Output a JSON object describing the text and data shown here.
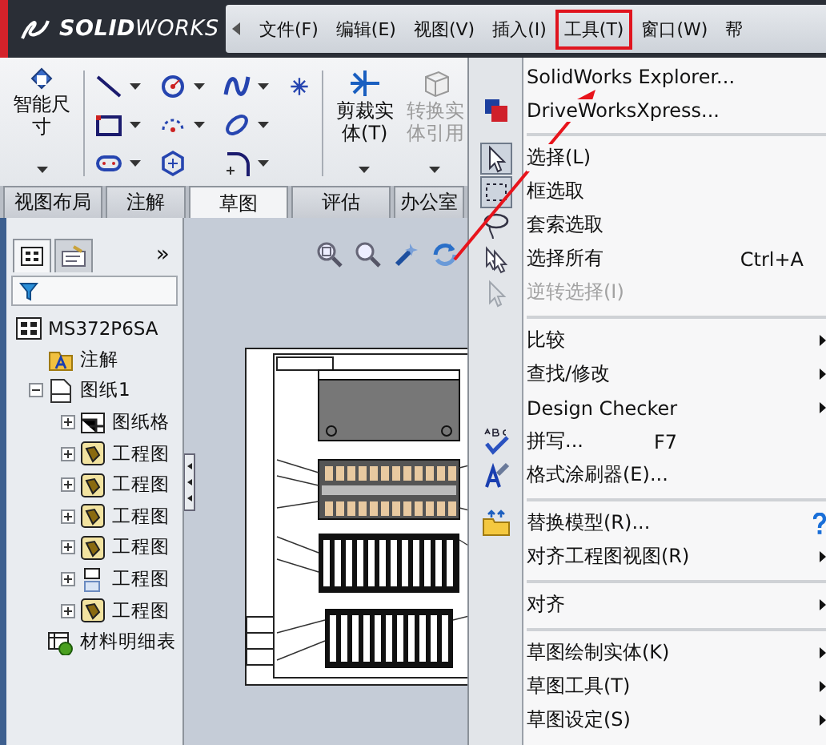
{
  "app": {
    "logo": "**SOLID**WORKS"
  },
  "menubar": {
    "items": [
      {
        "label": "文件(F)",
        "selected": false
      },
      {
        "label": "编辑(E)",
        "selected": false
      },
      {
        "label": "视图(V)",
        "selected": false
      },
      {
        "label": "插入(I)",
        "selected": false
      },
      {
        "label": "工具(T)",
        "selected": true
      },
      {
        "label": "窗口(W)",
        "selected": false
      },
      {
        "label": "帮",
        "selected": false
      }
    ]
  },
  "toolbar": {
    "buttons": [
      {
        "label": "智能尺寸",
        "disabled": false
      },
      {
        "label": "剪裁实体(T)",
        "disabled": false
      },
      {
        "label": "转换实体引用",
        "disabled": true
      }
    ]
  },
  "tabs": [
    {
      "label": "视图布局",
      "selected": false
    },
    {
      "label": "注解",
      "selected": false
    },
    {
      "label": "草图",
      "selected": true
    },
    {
      "label": "评估",
      "selected": false
    },
    {
      "label": "办公室",
      "selected": false
    }
  ],
  "panel": {
    "more": "»",
    "tree": {
      "label": "MS372P6SA",
      "kind": "drawing",
      "children": [
        {
          "label": "注解",
          "kind": "annotations"
        },
        {
          "label": "图纸1",
          "kind": "sheet",
          "expanded": true,
          "children": [
            {
              "label": "图纸格",
              "kind": "format",
              "expanded": false
            },
            {
              "label": "工程图",
              "kind": "view",
              "expanded": false
            },
            {
              "label": "工程图",
              "kind": "view",
              "expanded": false
            },
            {
              "label": "工程图",
              "kind": "view",
              "expanded": false
            },
            {
              "label": "工程图",
              "kind": "view",
              "expanded": false
            },
            {
              "label": "工程图",
              "kind": "blankview",
              "expanded": false
            },
            {
              "label": "工程图",
              "kind": "view",
              "expanded": false
            }
          ]
        },
        {
          "label": "材料明细表",
          "kind": "bom"
        }
      ]
    }
  },
  "menu": {
    "items": [
      {
        "kind": "item",
        "label": "SolidWorks Explorer...",
        "checked": false,
        "disabled": false,
        "submenu": false
      },
      {
        "kind": "item",
        "label": "DriveWorksXpress...",
        "checked": false,
        "disabled": false,
        "submenu": false
      },
      {
        "kind": "separator"
      },
      {
        "kind": "item",
        "label": "选择(L)",
        "checked": true,
        "disabled": false,
        "submenu": false
      },
      {
        "kind": "item",
        "label": "框选取",
        "checked": true,
        "disabled": false,
        "submenu": false
      },
      {
        "kind": "item",
        "label": "套索选取",
        "checked": false,
        "disabled": false,
        "submenu": false
      },
      {
        "kind": "item",
        "label": "选择所有",
        "shortcut": "Ctrl+A",
        "checked": false,
        "disabled": false,
        "submenu": false
      },
      {
        "kind": "item",
        "label": "逆转选择(I)",
        "checked": false,
        "disabled": true,
        "submenu": false
      },
      {
        "kind": "separator"
      },
      {
        "kind": "item",
        "label": "比较",
        "checked": false,
        "disabled": false,
        "submenu": true
      },
      {
        "kind": "item",
        "label": "查找/修改",
        "checked": false,
        "disabled": false,
        "submenu": true
      },
      {
        "kind": "item",
        "label": "Design Checker",
        "checked": false,
        "disabled": false,
        "submenu": true
      },
      {
        "kind": "item",
        "label": "拼写...",
        "shortcut": "F7",
        "checked": false,
        "disabled": false,
        "submenu": false
      },
      {
        "kind": "item",
        "label": "格式涂刷器(E)...",
        "checked": false,
        "disabled": false,
        "submenu": false
      },
      {
        "kind": "separator"
      },
      {
        "kind": "item",
        "label": "替换模型(R)...",
        "checked": false,
        "disabled": false,
        "submenu": false
      },
      {
        "kind": "item",
        "label": "对齐工程图视图(R)",
        "checked": false,
        "disabled": false,
        "submenu": true
      },
      {
        "kind": "separator"
      },
      {
        "kind": "item",
        "label": "对齐",
        "checked": false,
        "disabled": false,
        "submenu": true
      },
      {
        "kind": "separator"
      },
      {
        "kind": "item",
        "label": "草图绘制实体(K)",
        "checked": false,
        "disabled": false,
        "submenu": true
      },
      {
        "kind": "item",
        "label": "草图工具(T)",
        "checked": false,
        "disabled": false,
        "submenu": true
      },
      {
        "kind": "item",
        "label": "草图设定(S)",
        "checked": false,
        "disabled": false,
        "submenu": true
      }
    ]
  }
}
